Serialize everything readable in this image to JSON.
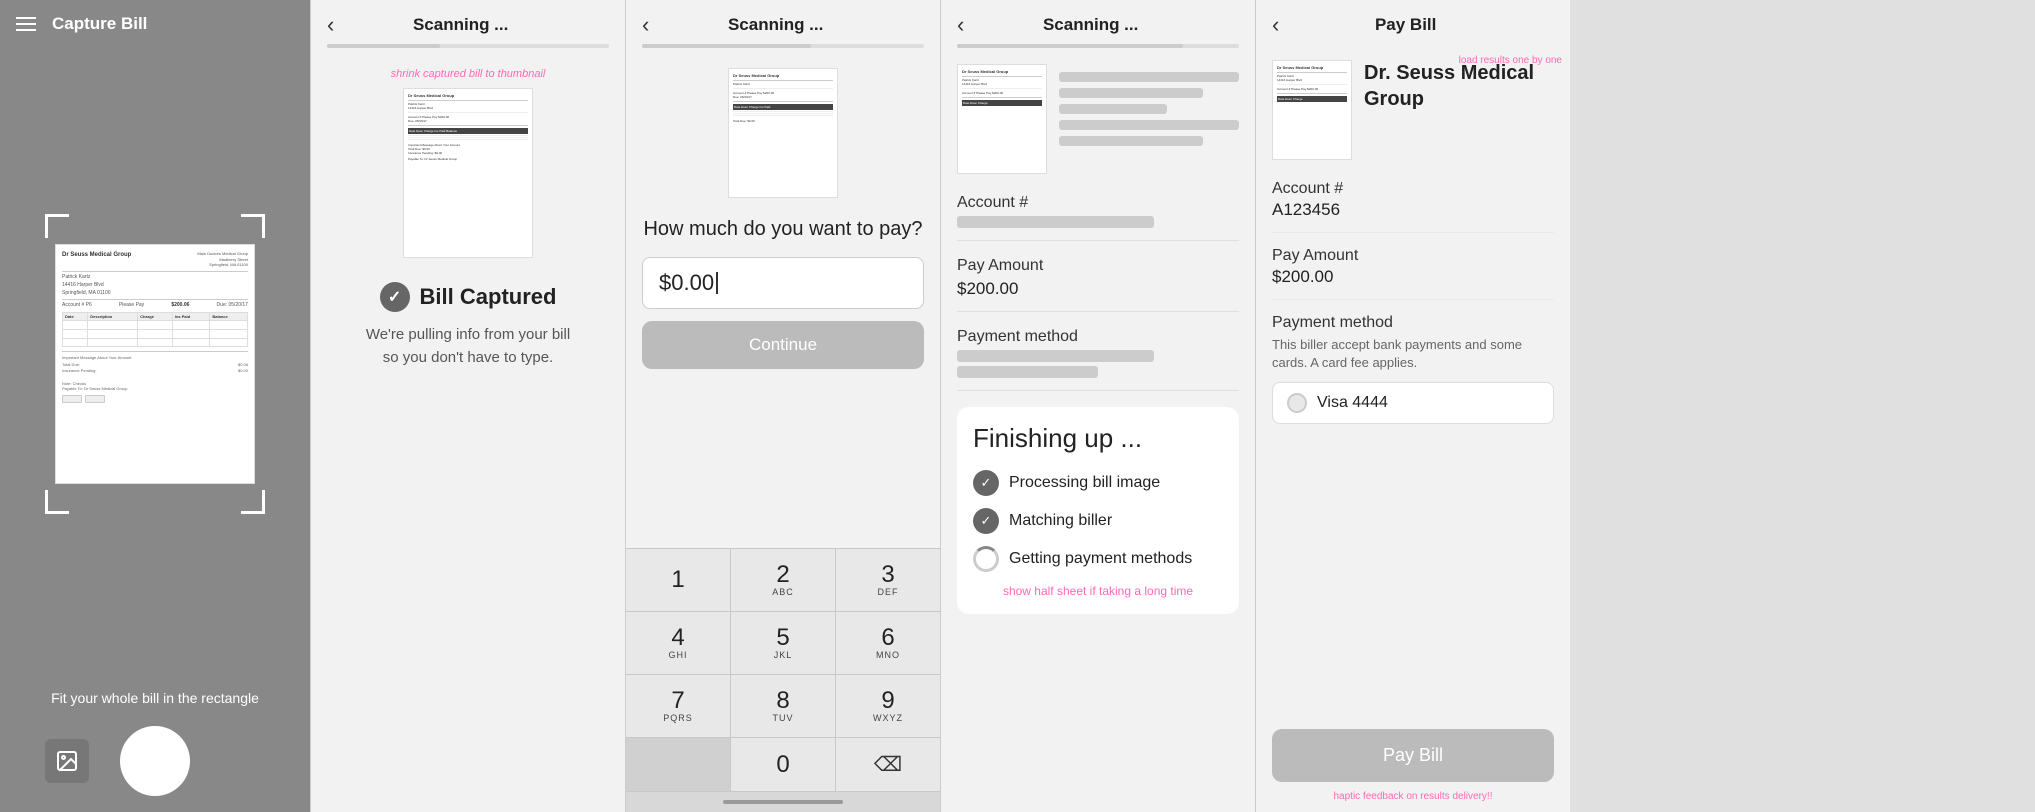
{
  "screen1": {
    "title": "Capture Bill",
    "hint": "Fit your whole bill in the rectangle",
    "hamburger_icon": "☰",
    "gallery_icon": "🖼",
    "bill": {
      "header": "Dr Seuss Medical Group",
      "address_right": "Main Doctors Medical Group\nMadberry Street\nSpringfield, MA 01100",
      "patient_name": "Patrick Kartz",
      "patient_address": "14416 Harper Blvd\nSpringfield, MA 01100",
      "account": "Account # P6",
      "please_pay": "Please Pay",
      "amount": "$200.06",
      "due_date": "Due: 05/20/17",
      "payable_to": "Payable To: Dr Seuss Medical Group"
    }
  },
  "screen2": {
    "title": "Scanning ...",
    "annotation": "shrink captured bill to thumbnail",
    "progress": 40,
    "status_title": "Bill Captured",
    "status_subtitle": "We're pulling info from your bill so you don't have to type.",
    "check_icon": "✓"
  },
  "screen3": {
    "title": "Scanning ...",
    "progress": 60,
    "question": "How much do you want to pay?",
    "amount_value": "$0.00",
    "continue_label": "Continue",
    "keys": [
      {
        "num": "1",
        "letters": ""
      },
      {
        "num": "2",
        "letters": "ABC"
      },
      {
        "num": "3",
        "letters": "DEF"
      },
      {
        "num": "4",
        "letters": "GHI"
      },
      {
        "num": "5",
        "letters": "JKL"
      },
      {
        "num": "6",
        "letters": "MNO"
      },
      {
        "num": "7",
        "letters": "PQRS"
      },
      {
        "num": "8",
        "letters": "TUV"
      },
      {
        "num": "9",
        "letters": "WXYZ"
      },
      {
        "num": "0",
        "letters": ""
      }
    ]
  },
  "screen4": {
    "title": "Scanning ...",
    "progress": 80,
    "account_label": "Account #",
    "pay_amount_label": "Pay Amount",
    "pay_amount_value": "$200.00",
    "payment_method_label": "Payment method",
    "finishing_title": "Finishing up ...",
    "steps": [
      {
        "label": "Processing bill image",
        "done": true
      },
      {
        "label": "Matching biller",
        "done": true
      },
      {
        "label": "Getting payment methods",
        "done": false
      }
    ],
    "show_link": "show half sheet if taking a long time"
  },
  "screen5": {
    "title": "Pay Bill",
    "annotation_load": "load results one by one",
    "biller_name": "Dr. Seuss Medical Group",
    "account_label": "Account #",
    "account_value": "A123456",
    "pay_amount_label": "Pay Amount",
    "pay_amount_value": "$200.00",
    "payment_method_label": "Payment method",
    "payment_method_desc": "This biller accept bank payments and some cards. A card fee applies.",
    "card_name": "Visa 4444",
    "pay_button_label": "Pay Bill",
    "haptic_note": "haptic feedback on results delivery!!"
  }
}
